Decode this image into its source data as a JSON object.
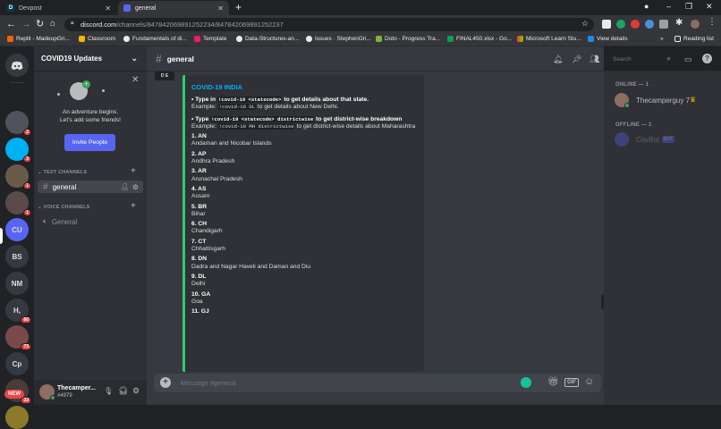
{
  "browser": {
    "tabs": [
      {
        "title": "Devpost",
        "favicon": "D"
      },
      {
        "title": "general",
        "favicon": ""
      }
    ],
    "new_tab": "+",
    "url_host": "discord.com",
    "url_path": "/channels/847842069891252234/847842069891252237",
    "bookmarks": [
      "Replit - MadeupGri...",
      "Classroom",
      "Fundamentals of di...",
      "Template",
      "Data-Structures-an...",
      "Issues · StephenGri...",
      "Doto - Progress Tra...",
      "FINAL450.xlsx - Go...",
      "Microsoft Learn Stu...",
      "View details"
    ],
    "bookmarks_more": "»",
    "reading_list": "Reading list",
    "window_controls": [
      "–",
      "❐",
      "✕"
    ]
  },
  "guilds": [
    {
      "label": "",
      "badge": "",
      "color": "#5865f2",
      "icon": "discord-home-icon"
    },
    {
      "label": "",
      "badge": "2",
      "color": "#4f545c",
      "icon": "server-avatar-icon"
    },
    {
      "label": "",
      "badge": "3",
      "color": "#00b0f4",
      "icon": "server-avatar-icon"
    },
    {
      "label": "",
      "badge": "1",
      "color": "#6a5a4a",
      "icon": "server-avatar-icon"
    },
    {
      "label": "",
      "badge": "1",
      "color": "#5a4a4a",
      "icon": "server-avatar-icon"
    },
    {
      "label": "CU",
      "badge": "",
      "color": "#5865f2",
      "icon": ""
    },
    {
      "label": "BS",
      "badge": "",
      "color": "#36393f",
      "icon": ""
    },
    {
      "label": "NM",
      "badge": "",
      "color": "#36393f",
      "icon": ""
    },
    {
      "label": "H,",
      "badge": "60",
      "color": "#36393f",
      "icon": ""
    },
    {
      "label": "",
      "badge": "73",
      "color": "#7a4a4a",
      "icon": "server-avatar-icon"
    },
    {
      "label": "Cp",
      "badge": "",
      "color": "#36393f",
      "icon": ""
    },
    {
      "label": "",
      "badge": "33",
      "color": "#4a3a3a",
      "icon": "server-avatar-icon"
    },
    {
      "label": "",
      "badge": "",
      "color": "#8a7a2a",
      "icon": "server-avatar-icon"
    }
  ],
  "guild_new_badge": "NEW",
  "server": {
    "name": "COVID19 Updates",
    "invite_text": "An adventure begins.\nLet's add some friends!",
    "invite_button": "Invite People",
    "text_category": "TEXT CHANNELS",
    "text_channels": [
      "general"
    ],
    "voice_category": "VOICE CHANNELS",
    "voice_channels": [
      "General"
    ]
  },
  "user": {
    "name": "Thecamper...",
    "tag": "#4979"
  },
  "chat": {
    "channel": "general",
    "search_placeholder": "Search",
    "composer_placeholder": "Message #general",
    "gif_label": "GIF"
  },
  "embed": {
    "title": "COVID-19 INDIA",
    "line1_prefix": "• Type in ",
    "line1_code": "!covid-19 <statecode>",
    "line1_suffix": " to get details about that state.",
    "ex1_prefix": "Example: ",
    "ex1_code": "!covid-19 DL",
    "ex1_suffix": " to get details about New Delhi.",
    "line2_prefix": "• Type ",
    "line2_code": "!covid-19 <statecode> districtwise",
    "line2_suffix": " to get district-wise breakdown",
    "ex2_prefix": "Example: ",
    "ex2_code": "!covid-19 MH districtwise",
    "ex2_suffix": " to get district-wise details about Maharashtra",
    "entries": [
      {
        "head": "1. AN",
        "name": "Andaman and Nicobar Islands"
      },
      {
        "head": "2. AP",
        "name": "Andhra Pradesh"
      },
      {
        "head": "3. AR",
        "name": "Arunachal Pradesh"
      },
      {
        "head": "4. AS",
        "name": "Assam"
      },
      {
        "head": "5. BR",
        "name": "Bihar"
      },
      {
        "head": "6. CH",
        "name": "Chandigarh"
      },
      {
        "head": "7. CT",
        "name": "Chhattisgarh"
      },
      {
        "head": "8. DN",
        "name": "Dadra and Nagar Haveli and Daman and Diu"
      },
      {
        "head": "9. DL",
        "name": "Delhi"
      },
      {
        "head": "10. GA",
        "name": "Goa"
      },
      {
        "head": "11. GJ",
        "name": ""
      }
    ]
  },
  "members": {
    "online_header": "ONLINE — 1",
    "online": [
      {
        "name": "Thecamperguy 7",
        "crown": "♛"
      }
    ],
    "offline_header": "OFFLINE — 1",
    "offline": [
      {
        "name": "CovBot",
        "tag": "BOT"
      }
    ]
  },
  "colors": {
    "accent": "#5865f2",
    "embed_border": "#2ecc71",
    "online": "#3ba55c",
    "badge": "#ed4245"
  }
}
